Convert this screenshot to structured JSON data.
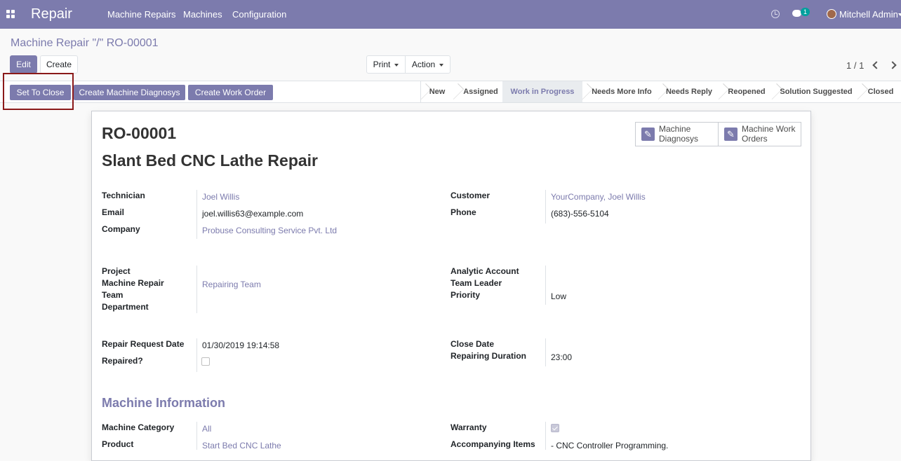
{
  "navbar": {
    "app_name": "Repair",
    "menu": [
      "Machine Repairs",
      "Machines",
      "Configuration"
    ],
    "chat_count": "1",
    "user": "Mitchell Admin"
  },
  "breadcrumb": "Machine Repair \"/\" RO-00001",
  "toolbar": {
    "edit": "Edit",
    "create": "Create",
    "print": "Print",
    "action": "Action",
    "pager": "1 / 1"
  },
  "statusbar": {
    "buttons": [
      "Set To Close",
      "Create Machine Diagnosys",
      "Create Work Order"
    ],
    "stages": [
      "New",
      "Assigned",
      "Work in Progress",
      "Needs More Info",
      "Needs Reply",
      "Reopened",
      "Solution Suggested",
      "Closed"
    ],
    "active_stage": "Work in Progress"
  },
  "record": {
    "reference": "RO-00001",
    "name": "Slant Bed CNC Lathe Repair"
  },
  "smart_buttons": [
    {
      "label": "Machine Diagnosys",
      "icon": "pencil-icon"
    },
    {
      "label": "Machine Work Orders",
      "icon": "pencil-icon"
    }
  ],
  "fields": {
    "technician_label": "Technician",
    "technician": "Joel Willis",
    "email_label": "Email",
    "email": "joel.willis63@example.com",
    "company_label": "Company",
    "company": "Probuse Consulting Service Pvt. Ltd",
    "customer_label": "Customer",
    "customer": "YourCompany, Joel Willis",
    "phone_label": "Phone",
    "phone": "(683)-556-5104",
    "project_label": "Project",
    "team_label": "Machine Repair Team",
    "team": "Repairing Team",
    "department_label": "Department",
    "analytic_label": "Analytic Account",
    "team_leader_label": "Team Leader",
    "priority_label": "Priority",
    "priority": "Low",
    "request_date_label": "Repair Request Date",
    "request_date": "01/30/2019 19:14:58",
    "repaired_label": "Repaired?",
    "repaired": false,
    "close_date_label": "Close Date",
    "duration_label": "Repairing Duration",
    "duration": "23:00"
  },
  "machine_info": {
    "section_title": "Machine Information",
    "category_label": "Machine Category",
    "category": "All",
    "product_label": "Product",
    "product": "Start Bed CNC Lathe",
    "warranty_label": "Warranty",
    "warranty": true,
    "accompanying_label": "Accompanying Items",
    "accompanying": "- CNC Controller Programming."
  },
  "colors": {
    "brand": "#7c7bad",
    "highlight_box": "#8b1a1a"
  }
}
